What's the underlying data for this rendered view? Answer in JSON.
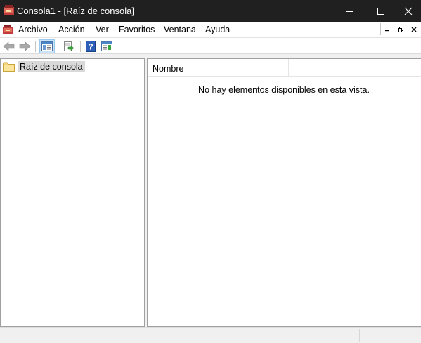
{
  "window": {
    "title": "Consola1 - [Raíz de consola]",
    "title_bar_color": "#202020"
  },
  "menu": {
    "items": [
      "Archivo",
      "Acción",
      "Ver",
      "Favoritos",
      "Ventana",
      "Ayuda"
    ]
  },
  "toolbar": {
    "buttons": [
      "back-icon",
      "forward-icon",
      "show-hide-console-tree-icon",
      "export-list-icon",
      "help-icon",
      "show-hide-action-pane-icon"
    ]
  },
  "tree": {
    "root_label": "Raíz de consola"
  },
  "list": {
    "column_name": "Nombre",
    "empty_message": "No hay elementos disponibles en esta vista."
  },
  "colors": {
    "selection": "#d9d9d9",
    "toolbar_active": "#cce4f7",
    "folder": "#f5d67a"
  }
}
